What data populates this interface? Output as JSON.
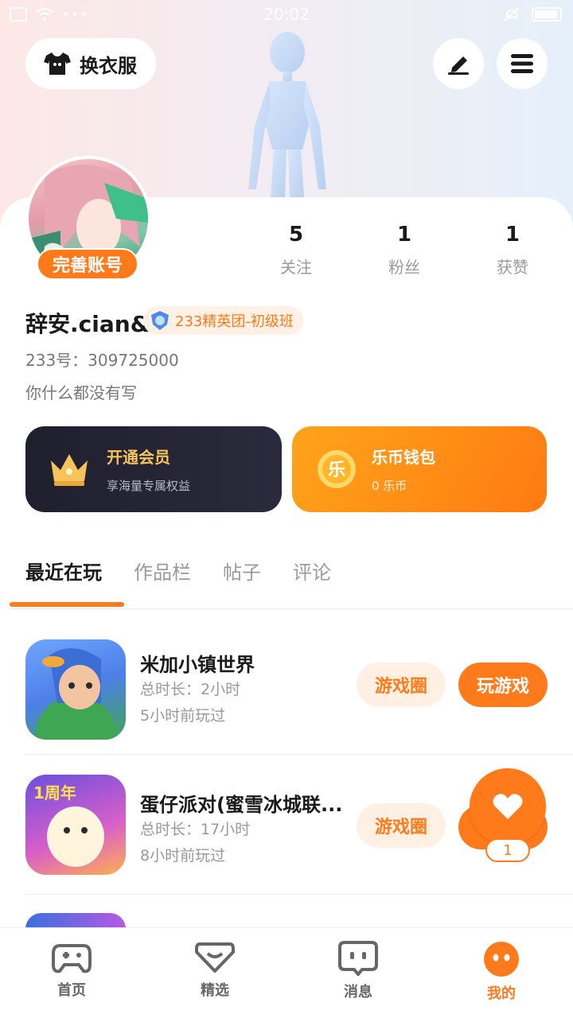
{
  "status_bar": {
    "time": "20:02"
  },
  "header": {
    "outfit_label": "换衣服"
  },
  "profile": {
    "complete_badge": "完善账号",
    "stats": [
      {
        "num": "5",
        "label": "关注"
      },
      {
        "num": "1",
        "label": "粉丝"
      },
      {
        "num": "1",
        "label": "获赞"
      }
    ],
    "username": "辞安.cian&",
    "rank_badge": "233精英团-初级班",
    "uid": "233号：309725000",
    "bio": "你什么都没有写"
  },
  "vip": {
    "title": "开通会员",
    "subtitle": "享海量专属权益"
  },
  "wallet": {
    "title": "乐币钱包",
    "subtitle": "0 乐币",
    "coin_glyph": "乐"
  },
  "tabs": [
    "最近在玩",
    "作品栏",
    "帖子",
    "评论"
  ],
  "games": [
    {
      "name": "米加小镇世界",
      "duration": "总时长：2小时",
      "last_played": "5小时前玩过",
      "circle_label": "游戏圈",
      "play_label": "玩游戏"
    },
    {
      "name": "蛋仔派对(蜜雪冰城联...",
      "duration": "总时长：17小时",
      "last_played": "8小时前玩过",
      "circle_label": "游戏圈",
      "icon_text": "1周年"
    }
  ],
  "like_float": {
    "count": "1"
  },
  "bottom_nav": [
    {
      "label": "首页",
      "icon": "gamepad-icon"
    },
    {
      "label": "精选",
      "icon": "heart-chat-icon"
    },
    {
      "label": "消息",
      "icon": "message-icon"
    },
    {
      "label": "我的",
      "icon": "profile-face-icon"
    }
  ],
  "colors": {
    "accent": "#ff7a1a",
    "accent_light": "#fff0e4",
    "vip_dark": "#23232f",
    "vip_gold": "#f5c35a"
  }
}
